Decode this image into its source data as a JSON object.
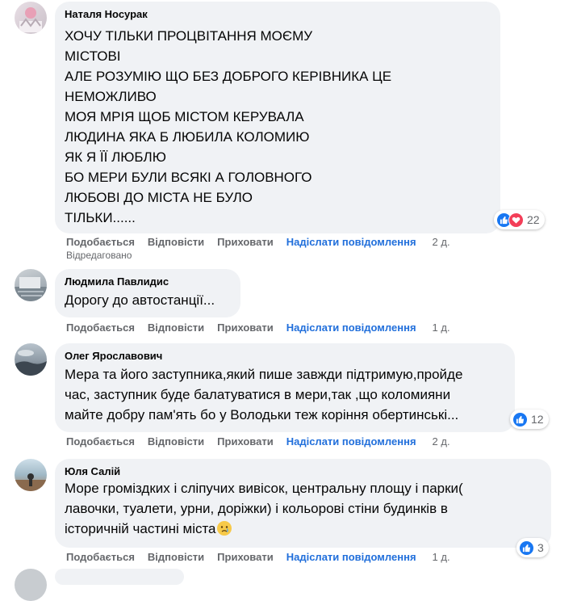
{
  "actions": {
    "like": "Подобається",
    "reply": "Відповісти",
    "hide": "Приховати",
    "send_message": "Надіслати повідомлення"
  },
  "comments": [
    {
      "author": "Наталя Носурак",
      "text": "ХОЧУ ТІЛЬКИ ПРОЦВІТАННЯ МОЄМУ\nМІСТОВІ\nАЛЕ РОЗУМІЮ ЩО БЕЗ ДОБРОГО КЕРІВНИКА ЦЕ\nНЕМОЖЛИВО\nМОЯ МРІЯ ЩОБ МІСТОМ КЕРУВАЛА\nЛЮДИНА ЯКА Б ЛЮБИЛА КОЛОМИЮ\nЯК Я ЇЇ ЛЮБЛЮ\nБО МЕРИ БУЛИ ВСЯКІ А ГОЛОВНОГО\nЛЮБОВІ ДО МІСТА НЕ БУЛО\nТІЛЬКИ......",
      "time": "2 д.",
      "edited": "Відредаговано",
      "reactions": "22"
    },
    {
      "author": "Людмила Павлидис",
      "text": "Дорогу до автостанції...",
      "time": "1 д."
    },
    {
      "author": "Олег Ярославович",
      "text": "Мера та його заступника,який пише завжди підтримую,пройде\nчас, заступник буде балатуватися в мери,так ,що коломияни\nмайте добру пам'ять бо у Володьки теж коріння обертинські...",
      "time": "2 д.",
      "reactions": "12"
    },
    {
      "author": "Юля Салій",
      "text": "Море громіздких і сліпучих вивісок, центральну площу і парки(\nлавочки, туалети, урни, доріжки) і кольорові стіни будинків в\nісторичній частині міста",
      "time": "1 д.",
      "reactions": "3"
    }
  ],
  "colors": {
    "bubble": "#f0f2f5",
    "action_gray": "#65676b",
    "send_blue": "#216fdb",
    "like_blue": "#1877f2",
    "love_red": "#f33e58"
  }
}
